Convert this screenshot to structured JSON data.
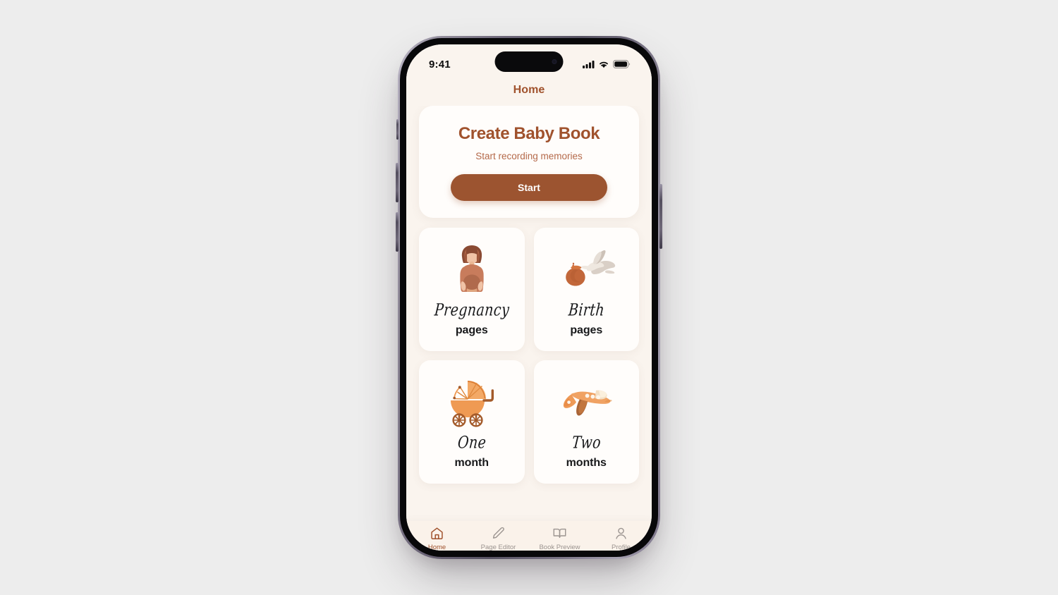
{
  "statusbar": {
    "time": "9:41",
    "signal_icon": "cellular-signal-icon",
    "wifi_icon": "wifi-icon",
    "battery_icon": "battery-icon"
  },
  "nav": {
    "title": "Home"
  },
  "hero": {
    "title": "Create Baby Book",
    "subtitle": "Start recording memories",
    "button_label": "Start"
  },
  "cards": [
    {
      "script": "Pregnancy",
      "bold": "pages",
      "art": "pregnant-woman-illustration"
    },
    {
      "script": "Birth",
      "bold": "pages",
      "art": "stork-with-bundle-illustration"
    },
    {
      "script": "One",
      "bold": "month",
      "art": "baby-pram-illustration"
    },
    {
      "script": "Two",
      "bold": "months",
      "art": "toy-airplane-illustration"
    }
  ],
  "tabs": [
    {
      "label": "Home",
      "icon": "home-icon",
      "active": true
    },
    {
      "label": "Page Editor",
      "icon": "pencil-icon",
      "active": false
    },
    {
      "label": "Book Preview",
      "icon": "open-book-icon",
      "active": false
    },
    {
      "label": "Profile",
      "icon": "person-icon",
      "active": false
    }
  ],
  "colors": {
    "brand_brown": "#a0522d",
    "button_brown": "#9c5430",
    "app_background": "#faf4ee",
    "card_background": "#fffdfb",
    "tabbar_background": "#faf2ea",
    "inactive_tab": "#9b9490",
    "page_background": "#ededed",
    "illustration_orange": "#ef9a53"
  }
}
